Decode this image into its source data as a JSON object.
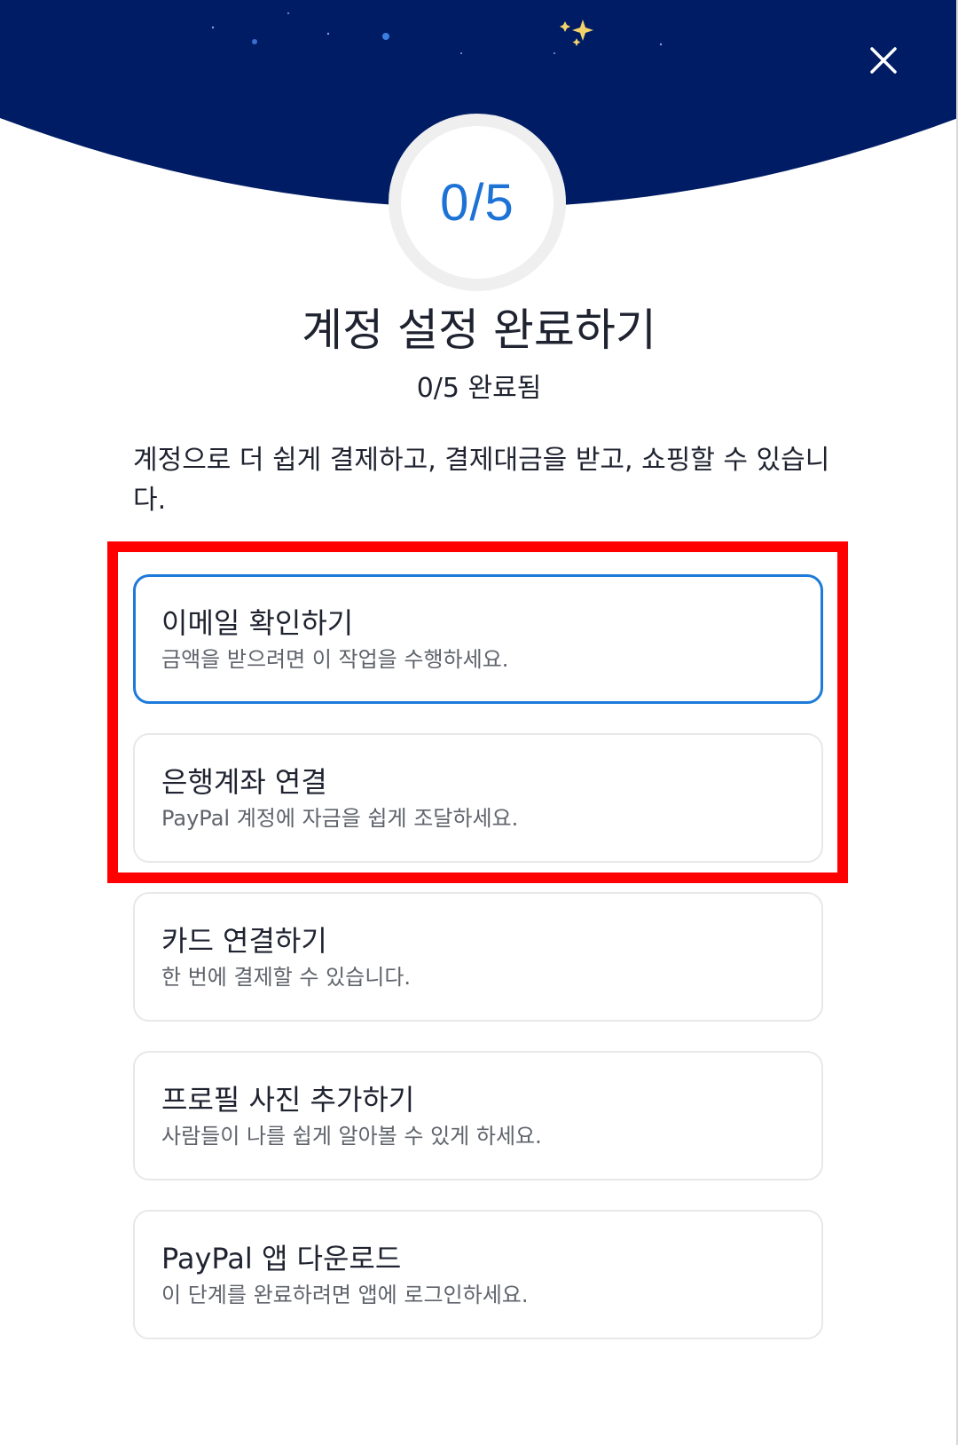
{
  "header": {
    "close_icon": "close-icon",
    "sky_color": "#001c64"
  },
  "progress": {
    "label": "0/5",
    "completed": 0,
    "total": 5,
    "accent_color": "#1d72d6"
  },
  "title": "계정 설정 완료하기",
  "subtitle": "0/5 완료됨",
  "description": "계정으로 더 쉽게 결제하고, 결제대금을 받고, 쇼핑할 수 있습니다.",
  "tasks": [
    {
      "title": "이메일 확인하기",
      "subtitle": "금액을 받으려면 이 작업을 수행하세요.",
      "active": true
    },
    {
      "title": "은행계좌 연결",
      "subtitle": "PayPal 계정에 자금을 쉽게 조달하세요.",
      "active": false
    },
    {
      "title": "카드 연결하기",
      "subtitle": "한 번에 결제할 수 있습니다.",
      "active": false
    },
    {
      "title": "프로필 사진 추가하기",
      "subtitle": "사람들이 나를 쉽게 알아볼 수 있게 하세요.",
      "active": false
    },
    {
      "title": "PayPal 앱 다운로드",
      "subtitle": "이 단계를 완료하려면 앱에 로그인하세요.",
      "active": false
    }
  ],
  "annotation": {
    "highlight_color": "#ff0000"
  }
}
